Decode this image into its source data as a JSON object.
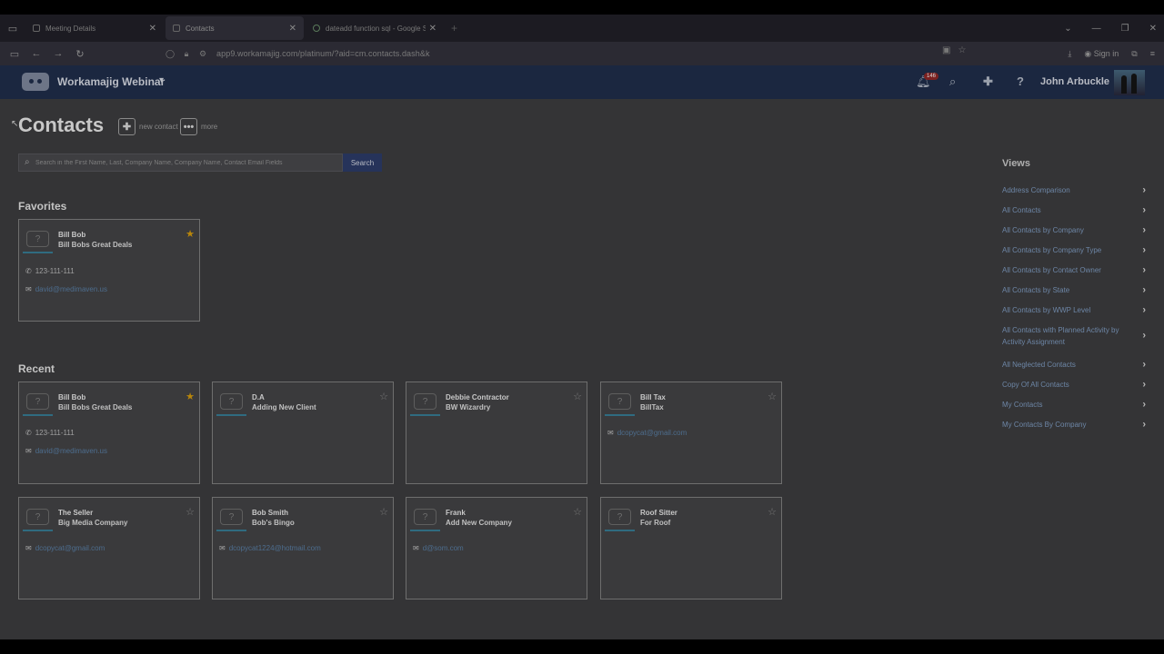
{
  "browser": {
    "tabs": [
      {
        "title": "Meeting Details",
        "active": false
      },
      {
        "title": "Contacts",
        "active": true
      },
      {
        "title": "dateadd function sql - Google S",
        "active": false
      }
    ],
    "url": "app9.workamajig.com/platinum/?aid=cm.contacts.dash&k",
    "signin_label": "Sign in"
  },
  "header": {
    "brand": "Workamajig Webinar",
    "notifications_count": "146",
    "user_name": "John Arbuckle"
  },
  "page": {
    "title": "Contacts",
    "new_contact_label": "new contact",
    "more_label": "more",
    "search_placeholder": "Search in the First Name, Last, Company Name, Company Name, Contact Email Fields",
    "search_button": "Search"
  },
  "favorites": {
    "title": "Favorites",
    "cards": [
      {
        "name": "Bill Bob",
        "company": "Bill Bobs Great Deals",
        "phone": "123-111-111",
        "email": "david@medimaven.us",
        "starred": true
      }
    ]
  },
  "recent": {
    "title": "Recent",
    "cards": [
      {
        "name": "Bill Bob",
        "company": "Bill Bobs Great Deals",
        "phone": "123-111-111",
        "email": "david@medimaven.us",
        "starred": true
      },
      {
        "name": "D.A",
        "company": "Adding New Client",
        "phone": "",
        "email": "",
        "starred": false
      },
      {
        "name": "Debbie Contractor",
        "company": "BW Wizardry",
        "phone": "",
        "email": "",
        "starred": false
      },
      {
        "name": "Bill Tax",
        "company": "BillTax",
        "phone": "",
        "email": "dcopycat@gmail.com",
        "starred": false
      },
      {
        "name": "The Seller",
        "company": "Big Media Company",
        "phone": "",
        "email": "dcopycat@gmail.com",
        "starred": false
      },
      {
        "name": "Bob Smith",
        "company": "Bob's Bingo",
        "phone": "",
        "email": "dcopycat1224@hotmail.com",
        "starred": false
      },
      {
        "name": "Frank",
        "company": "Add New Company",
        "phone": "",
        "email": "d@som.com",
        "starred": false
      },
      {
        "name": "Roof Sitter",
        "company": "For Roof",
        "phone": "",
        "email": "",
        "starred": false
      }
    ]
  },
  "views": {
    "title": "Views",
    "items": [
      "Address Comparison",
      "All Contacts",
      "All Contacts by Company",
      "All Contacts by Company Type",
      "All Contacts by Contact Owner",
      "All Contacts by State",
      "All Contacts by WWP Level",
      "All Contacts with Planned Activity by Activity Assignment",
      "All Neglected Contacts",
      "Copy Of All Contacts",
      "My Contacts",
      "My Contacts By Company"
    ]
  },
  "colors": {
    "header_bg": "#1b2740",
    "search_button_bg": "#26335a",
    "star_active": "#b8860b",
    "link": "#6d86a6"
  }
}
